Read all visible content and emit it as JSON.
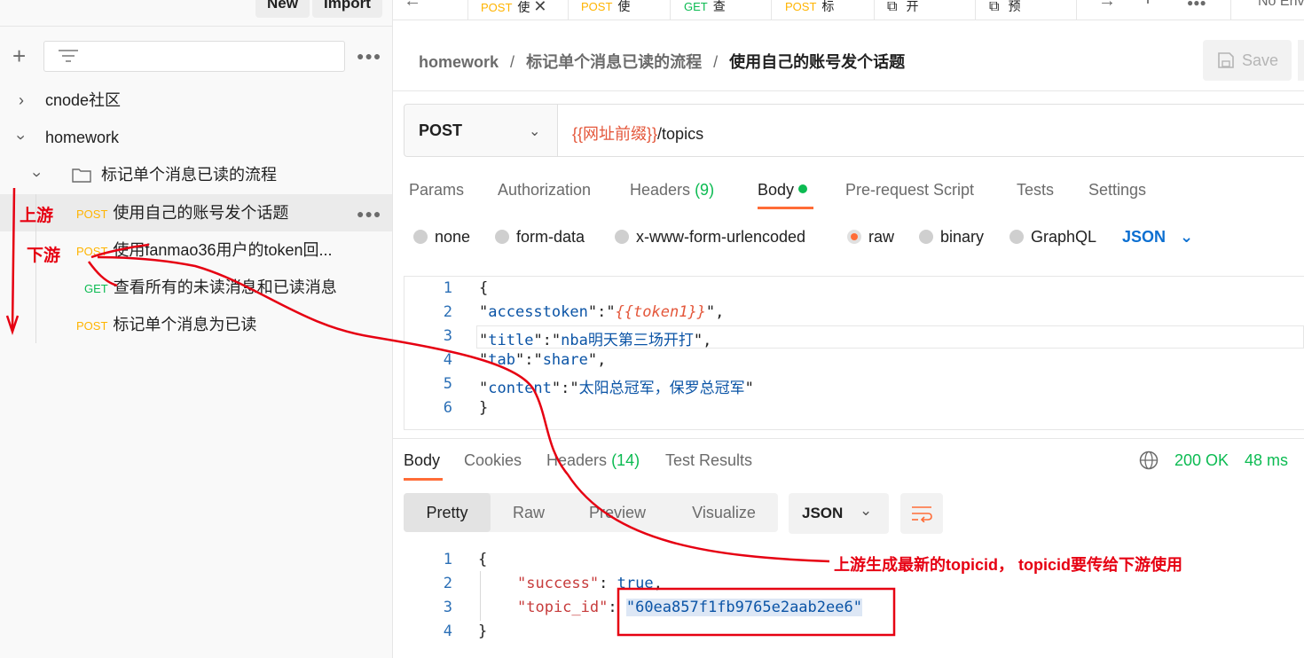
{
  "sidebar": {
    "new_label": "New",
    "import_label": "Import",
    "tree": [
      {
        "label": "cnode社区",
        "expanded": false
      },
      {
        "label": "homework",
        "expanded": true
      },
      {
        "label": "标记单个消息已读的流程",
        "expanded": true,
        "folder": true
      },
      {
        "method": "POST",
        "label": "使用自己的账号发个话题",
        "active": true
      },
      {
        "method": "POST",
        "label": "使用fanmao36用户的token回..."
      },
      {
        "method": "GET",
        "label": "查看所有的未读消息和已读消息"
      },
      {
        "method": "POST",
        "label": "标记单个消息为已读"
      }
    ]
  },
  "tabs": [
    {
      "method": "POST",
      "label": "使"
    },
    {
      "method": "POST",
      "label": "使"
    },
    {
      "method": "GET",
      "label": "查"
    },
    {
      "method": "POST",
      "label": "标"
    },
    {
      "label": "开"
    },
    {
      "label": "预"
    }
  ],
  "env_label": "No Env",
  "breadcrumb": [
    "homework",
    "标记单个消息已读的流程",
    "使用自己的账号发个话题"
  ],
  "save_label": "Save",
  "request": {
    "method": "POST",
    "url_var": "{{网址前缀}}",
    "url_path": "/topics",
    "tabs": {
      "params": "Params",
      "auth": "Authorization",
      "headers": "Headers",
      "headers_count": "(9)",
      "body": "Body",
      "prereq": "Pre-request Script",
      "tests": "Tests",
      "settings": "Settings"
    },
    "body_types": [
      "none",
      "form-data",
      "x-www-form-urlencoded",
      "raw",
      "binary",
      "GraphQL"
    ],
    "body_format": "JSON",
    "body_lines": [
      {
        "n": "1",
        "text": "{"
      },
      {
        "n": "2",
        "key": "accesstoken",
        "var": "{{token1}}"
      },
      {
        "n": "3",
        "key": "title",
        "val": "nba明天第三场开打"
      },
      {
        "n": "4",
        "key": "tab",
        "val": "share"
      },
      {
        "n": "5",
        "key": "content",
        "val": "太阳总冠军，保罗总冠军"
      },
      {
        "n": "6",
        "text": "}"
      }
    ]
  },
  "response": {
    "tabs": {
      "body": "Body",
      "cookies": "Cookies",
      "headers": "Headers",
      "headers_count": "(14)",
      "tests": "Test Results"
    },
    "status": "200 OK",
    "time": "48 ms",
    "views": [
      "Pretty",
      "Raw",
      "Preview",
      "Visualize"
    ],
    "format": "JSON",
    "lines": [
      {
        "n": "1",
        "text": "{"
      },
      {
        "n": "2",
        "key": "\"success\"",
        "val": "true"
      },
      {
        "n": "3",
        "key": "\"topic_id\"",
        "val": "\"60ea857f1fb9765e2aab2ee6\""
      },
      {
        "n": "4",
        "text": "}"
      }
    ]
  },
  "annotations": {
    "upstream": "上游",
    "downstream": "下游",
    "note": "上游生成最新的topicid， topicid要传给下游使用"
  },
  "colors": {
    "accent": "#ff6c37",
    "annotation": "#e60012",
    "post": "#ffb400",
    "get": "#0cbb52",
    "ok": "#0cbb52"
  }
}
